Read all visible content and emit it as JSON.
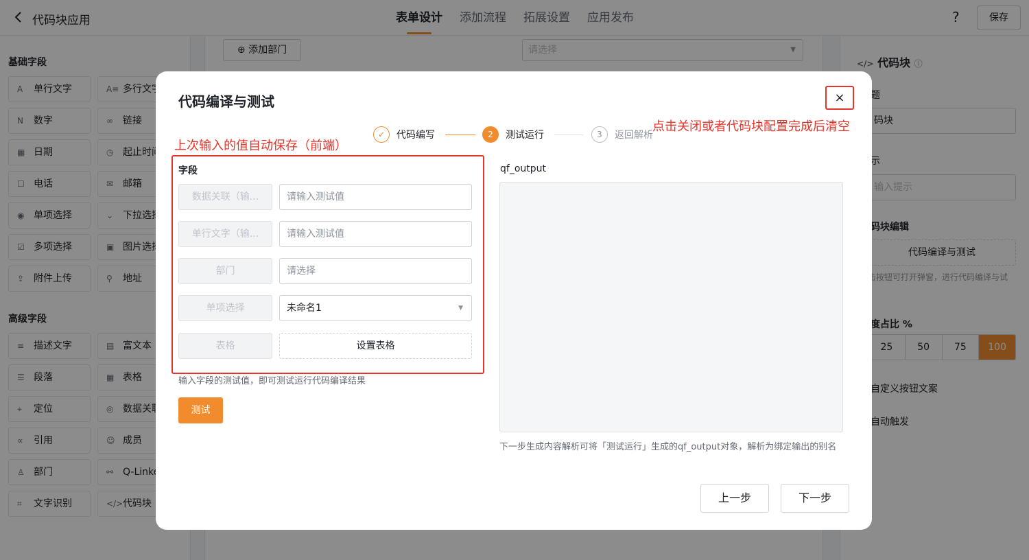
{
  "header": {
    "app_title": "代码块应用",
    "tabs": [
      {
        "label": "表单设计",
        "active": true
      },
      {
        "label": "添加流程",
        "active": false
      },
      {
        "label": "拓展设置",
        "active": false
      },
      {
        "label": "应用发布",
        "active": false
      }
    ],
    "help_label": "?",
    "save_label": "保存"
  },
  "left_panel": {
    "basic_title": "基础字段",
    "basic_fields": [
      {
        "label": "单行文字",
        "icon": "A",
        "icon_name": "text-icon"
      },
      {
        "label": "多行文字",
        "icon": "A≡",
        "icon_name": "multiline-text-icon"
      },
      {
        "label": "数字",
        "icon": "N",
        "icon_name": "number-icon"
      },
      {
        "label": "链接",
        "icon": "∞",
        "icon_name": "link-icon"
      },
      {
        "label": "日期",
        "icon": "▦",
        "icon_name": "calendar-icon"
      },
      {
        "label": "起止时间",
        "icon": "◷",
        "icon_name": "clock-icon"
      },
      {
        "label": "电话",
        "icon": "☐",
        "icon_name": "phone-icon"
      },
      {
        "label": "邮箱",
        "icon": "✉",
        "icon_name": "mail-icon"
      },
      {
        "label": "单项选择",
        "icon": "◉",
        "icon_name": "radio-icon"
      },
      {
        "label": "下拉选择",
        "icon": "⌄",
        "icon_name": "dropdown-icon"
      },
      {
        "label": "多项选择",
        "icon": "☑",
        "icon_name": "checkbox-icon"
      },
      {
        "label": "图片选择",
        "icon": "▣",
        "icon_name": "image-icon"
      },
      {
        "label": "附件上传",
        "icon": "⇪",
        "icon_name": "upload-icon"
      },
      {
        "label": "地址",
        "icon": "⚲",
        "icon_name": "address-icon"
      }
    ],
    "advanced_title": "高级字段",
    "advanced_fields": [
      {
        "label": "描述文字",
        "icon": "≡",
        "icon_name": "description-icon"
      },
      {
        "label": "富文本",
        "icon": "▤",
        "icon_name": "rich-text-icon"
      },
      {
        "label": "段落",
        "icon": "☰",
        "icon_name": "paragraph-icon"
      },
      {
        "label": "表格",
        "icon": "▦",
        "icon_name": "table-icon"
      },
      {
        "label": "定位",
        "icon": "⌖",
        "icon_name": "location-icon"
      },
      {
        "label": "数据关联",
        "icon": "◎",
        "icon_name": "data-link-icon"
      },
      {
        "label": "引用",
        "icon": "∝",
        "icon_name": "reference-icon"
      },
      {
        "label": "成员",
        "icon": "☺",
        "icon_name": "member-icon"
      },
      {
        "label": "部门",
        "icon": "♙",
        "icon_name": "department-icon"
      },
      {
        "label": "Q-Linker",
        "icon": "⚯",
        "icon_name": "qlinker-icon"
      },
      {
        "label": "文字识别",
        "icon": "⌗",
        "icon_name": "ocr-icon"
      },
      {
        "label": "代码块",
        "icon": "</>",
        "icon_name": "code-icon"
      }
    ]
  },
  "canvas": {
    "add_department_label": "添加部门",
    "select_placeholder": "请选择"
  },
  "right_panel": {
    "title": "代码块",
    "partial_labels": [
      "题",
      "码块",
      "示",
      "输入提示",
      "码块编辑",
      "代码编译与测试",
      "击按钮可打开弹窗，进行代码编译与试",
      "度占比 %",
      "自定义按钮文案",
      "自动触发"
    ],
    "width_options": [
      "25",
      "50",
      "75",
      "100"
    ]
  },
  "modal": {
    "title": "代码编译与测试",
    "close_icon": "×",
    "note_close": "点击关闭或者代码块配置完成后清空",
    "note_autosave": "上次输入的值自动保存（前端）",
    "steps": [
      {
        "num": "✓",
        "label": "代码编写",
        "state": "done"
      },
      {
        "num": "2",
        "label": "测试运行",
        "state": "active"
      },
      {
        "num": "3",
        "label": "返回解析",
        "state": "pending"
      }
    ],
    "fields_label": "字段",
    "fields": [
      {
        "name": "数据关联（输...",
        "value": "",
        "placeholder": "请输入测试值",
        "type": "input"
      },
      {
        "name": "单行文字（输...",
        "value": "",
        "placeholder": "请输入测试值",
        "type": "input"
      },
      {
        "name": "部门",
        "value": "",
        "placeholder": "请选择",
        "type": "input"
      },
      {
        "name": "单项选择",
        "value": "未命名1",
        "placeholder": "",
        "type": "select"
      },
      {
        "name": "表格",
        "value": "设置表格",
        "placeholder": "",
        "type": "button"
      }
    ],
    "hint": "输入字段的测试值，即可测试运行代码编译结果",
    "test_label": "测试",
    "output_label": "qf_output",
    "output_hint": "下一步生成内容解析可将「测试运行」生成的qf_output对象，解析为绑定输出的别名",
    "prev_label": "上一步",
    "next_label": "下一步"
  },
  "colors": {
    "accent": "#f08c2e",
    "annotation_red": "#e5352b"
  }
}
